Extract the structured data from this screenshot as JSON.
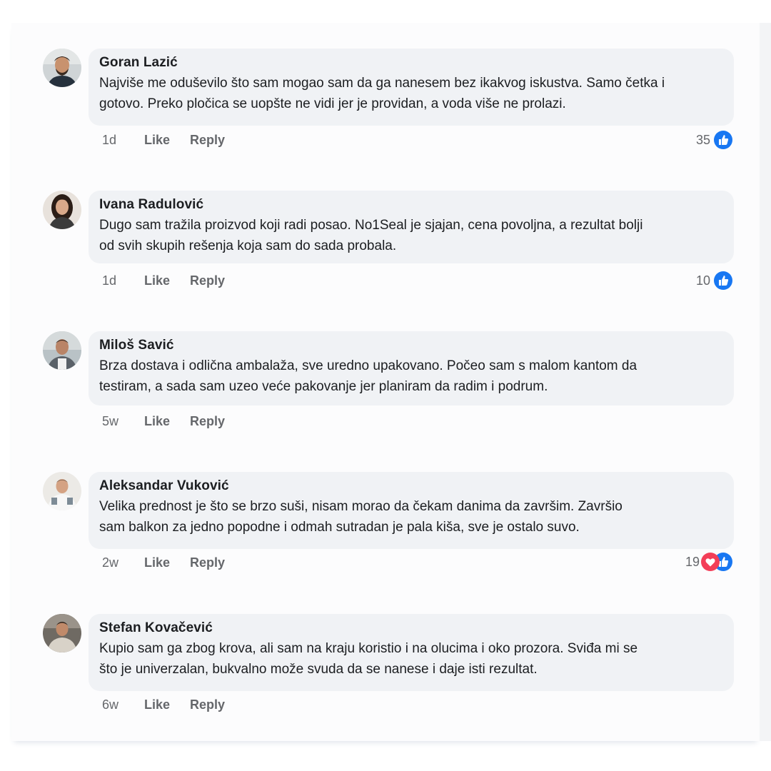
{
  "comments": [
    {
      "author": "Goran Lazić",
      "lines": [
        "Najviše me oduševilo što sam mogao sam da ga nanesem bez ikakvog iskustva. Samo četka i",
        "gotovo. Preko pločica se uopšte ne vidi jer je providan, a voda više ne prolazi."
      ],
      "time": "1d",
      "like_label": "Like",
      "reply_label": "Reply",
      "reaction_count": "35",
      "reactions": [
        "like-icon"
      ]
    },
    {
      "author": "Ivana Radulović",
      "lines": [
        "Dugo sam tražila proizvod koji radi posao. No1Seal je sjajan, cena povoljna, a rezultat bolji",
        "od svih skupih rešenja koja sam do sada probala."
      ],
      "time": "1d",
      "like_label": "Like",
      "reply_label": "Reply",
      "reaction_count": "10",
      "reactions": [
        "like-icon"
      ]
    },
    {
      "author": "Miloš Savić",
      "lines": [
        "Brza dostava i odlična ambalaža, sve uredno upakovano. Počeo sam s malom kantom da",
        "testiram, a sada sam uzeo veće pakovanje jer planiram da radim i podrum."
      ],
      "time": "5w",
      "like_label": "Like",
      "reply_label": "Reply",
      "reaction_count": "",
      "reactions": []
    },
    {
      "author": "Aleksandar Vuković",
      "lines": [
        "Velika prednost je što se brzo suši, nisam morao da čekam danima da završim. Završio",
        "sam balkon za jedno popodne i odmah sutradan je pala kiša, sve je ostalo suvo."
      ],
      "time": "2w",
      "like_label": "Like",
      "reply_label": "Reply",
      "reaction_count": "19",
      "reactions": [
        "love-icon",
        "like-icon"
      ]
    },
    {
      "author": "Stefan Kovačević",
      "lines": [
        "Kupio sam ga zbog krova, ali sam na kraju koristio i na olucima i oko prozora. Sviđa mi se",
        "što je univerzalan, bukvalno može svuda da se nanese i daje isti rezultat."
      ],
      "time": "6w",
      "like_label": "Like",
      "reply_label": "Reply",
      "reaction_count": "",
      "reactions": []
    }
  ],
  "colors": {
    "bubble": "#f0f2f5",
    "text": "#1c1e21",
    "meta": "#65676b",
    "like_blue": "#1877f2",
    "love_red": "#f33e58"
  }
}
